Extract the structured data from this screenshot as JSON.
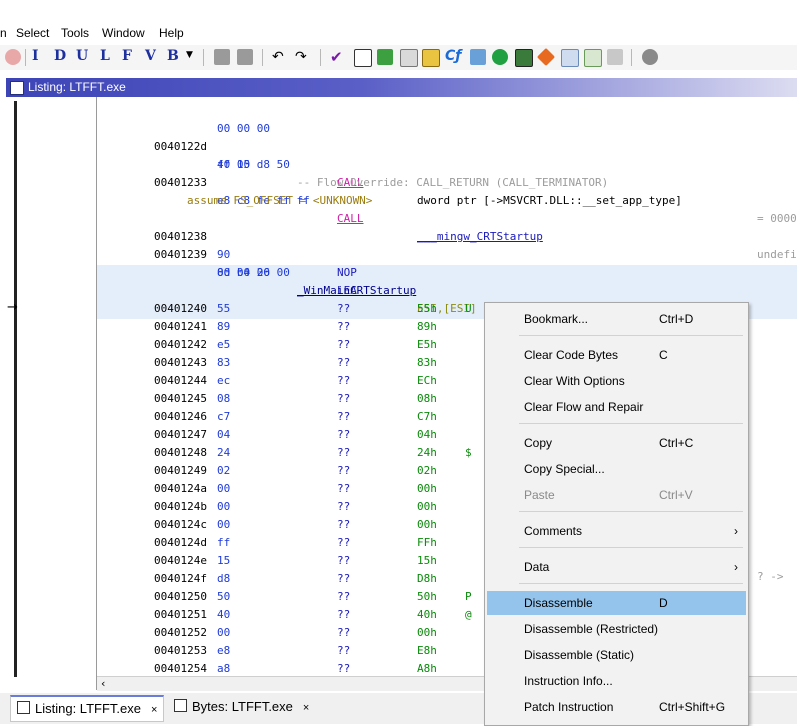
{
  "menubar": {
    "items": [
      "n",
      "Select",
      "Tools",
      "Window",
      "Help"
    ]
  },
  "toolbar": {
    "letters": [
      "I",
      "D",
      "U",
      "L",
      "F",
      "V",
      "B"
    ]
  },
  "window": {
    "title": "Listing:  LTFFT.exe"
  },
  "listing": {
    "lines": [
      {
        "addr": "",
        "bytes": "00 00 00",
        "mn": "",
        "op": "",
        "cm": ""
      },
      {
        "addr": "0040122d",
        "bytes": "ff 15 d8 50",
        "mn": "CALL",
        "op": "dword ptr [->MSVCRT.DLL::__set_app_type]",
        "cm": "= 0000"
      },
      {
        "addr": "",
        "bytes": "40 00",
        "mn": "",
        "op": "",
        "cm": ""
      },
      {
        "addr": "00401233",
        "bytes": "e8 c8 fe ff ff",
        "mn": "CALL",
        "op": "___mingw_CRTStartup",
        "cm": "undefi"
      }
    ],
    "flow_override": "-- Flow Override: CALL_RETURN (CALL_TERMINATOR)",
    "assume": "assume FS_OFFSET = <UNKNOWN>",
    "nop_line": {
      "addr": "00401238",
      "bytes": "90",
      "mn": "NOP"
    },
    "lea_line": {
      "addr": "00401239",
      "bytes": "8d b4 26 00",
      "mn": "LEA",
      "op": "ESI,[ESI]"
    },
    "lea_cont": "00 00 00",
    "function_label": "_WinMainCRTStartup",
    "undefined_rows": [
      {
        "addr": "00401240",
        "byte": "55",
        "q": "??",
        "val": "55h",
        "ch": "U"
      },
      {
        "addr": "00401241",
        "byte": "89",
        "q": "??",
        "val": "89h",
        "ch": ""
      },
      {
        "addr": "00401242",
        "byte": "e5",
        "q": "??",
        "val": "E5h",
        "ch": ""
      },
      {
        "addr": "00401243",
        "byte": "83",
        "q": "??",
        "val": "83h",
        "ch": ""
      },
      {
        "addr": "00401244",
        "byte": "ec",
        "q": "??",
        "val": "ECh",
        "ch": ""
      },
      {
        "addr": "00401245",
        "byte": "08",
        "q": "??",
        "val": "08h",
        "ch": ""
      },
      {
        "addr": "00401246",
        "byte": "c7",
        "q": "??",
        "val": "C7h",
        "ch": ""
      },
      {
        "addr": "00401247",
        "byte": "04",
        "q": "??",
        "val": "04h",
        "ch": ""
      },
      {
        "addr": "00401248",
        "byte": "24",
        "q": "??",
        "val": "24h",
        "ch": "$"
      },
      {
        "addr": "00401249",
        "byte": "02",
        "q": "??",
        "val": "02h",
        "ch": ""
      },
      {
        "addr": "0040124a",
        "byte": "00",
        "q": "??",
        "val": "00h",
        "ch": ""
      },
      {
        "addr": "0040124b",
        "byte": "00",
        "q": "??",
        "val": "00h",
        "ch": ""
      },
      {
        "addr": "0040124c",
        "byte": "00",
        "q": "??",
        "val": "00h",
        "ch": ""
      },
      {
        "addr": "0040124d",
        "byte": "ff",
        "q": "??",
        "val": "FFh",
        "ch": ""
      },
      {
        "addr": "0040124e",
        "byte": "15",
        "q": "??",
        "val": "15h",
        "ch": ""
      },
      {
        "addr": "0040124f",
        "byte": "d8",
        "q": "??",
        "val": "D8h",
        "ch": ""
      },
      {
        "addr": "00401250",
        "byte": "50",
        "q": "??",
        "val": "50h",
        "ch": "P"
      },
      {
        "addr": "00401251",
        "byte": "40",
        "q": "??",
        "val": "40h",
        "ch": "@"
      },
      {
        "addr": "00401252",
        "byte": "00",
        "q": "??",
        "val": "00h",
        "ch": ""
      },
      {
        "addr": "00401253",
        "byte": "e8",
        "q": "??",
        "val": "E8h",
        "ch": ""
      },
      {
        "addr": "00401254",
        "byte": "a8",
        "q": "??",
        "val": "A8h",
        "ch": ""
      }
    ],
    "side_comment": "? ->"
  },
  "context_menu": {
    "items": [
      {
        "label": "Bookmark...",
        "shortcut": "Ctrl+D"
      },
      {
        "label": "Clear Code Bytes",
        "shortcut": "C"
      },
      {
        "label": "Clear With Options",
        "shortcut": ""
      },
      {
        "label": "Clear Flow and Repair",
        "shortcut": ""
      },
      {
        "label": "Copy",
        "shortcut": "Ctrl+C"
      },
      {
        "label": "Copy Special...",
        "shortcut": ""
      },
      {
        "label": "Paste",
        "shortcut": "Ctrl+V"
      },
      {
        "label": "Comments",
        "shortcut": ""
      },
      {
        "label": "Data",
        "shortcut": ""
      },
      {
        "label": "Disassemble",
        "shortcut": "D"
      },
      {
        "label": "Disassemble (Restricted)",
        "shortcut": ""
      },
      {
        "label": "Disassemble (Static)",
        "shortcut": ""
      },
      {
        "label": "Instruction Info...",
        "shortcut": ""
      },
      {
        "label": "Patch Instruction",
        "shortcut": "Ctrl+Shift+G"
      }
    ],
    "submenu_glyph": "›"
  },
  "tabs": [
    {
      "label": "Listing:  LTFFT.exe",
      "close": "×"
    },
    {
      "label": "Bytes: LTFFT.exe",
      "close": "×"
    }
  ],
  "colors": {
    "title_gradient_start": "#3d44b6",
    "selection": "#94c4ec",
    "call_color": "#d01ea8",
    "bytes_color": "#1f3bd8",
    "value_color": "#0a8a0a"
  }
}
